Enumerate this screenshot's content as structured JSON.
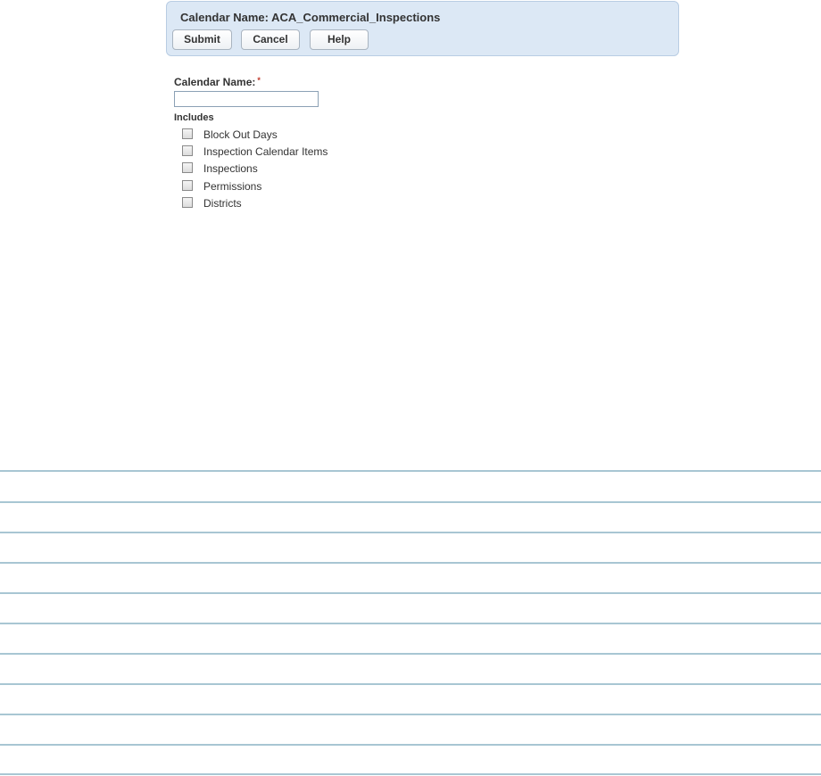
{
  "header": {
    "title": "Calendar Name: ACA_Commercial_Inspections",
    "buttons": {
      "submit": "Submit",
      "cancel": "Cancel",
      "help": "Help"
    }
  },
  "form": {
    "calendar_name_label": "Calendar Name:",
    "required_marker": "*",
    "calendar_name_value": "",
    "includes_label": "Includes",
    "includes": [
      {
        "label": "Block Out Days",
        "checked": false
      },
      {
        "label": "Inspection Calendar Items",
        "checked": false
      },
      {
        "label": "Inspections",
        "checked": false
      },
      {
        "label": "Permissions",
        "checked": false
      },
      {
        "label": "Districts",
        "checked": false
      }
    ]
  },
  "colors": {
    "header_bg": "#dce8f5",
    "header_border": "#b9cde3",
    "rule_line": "#a8c6d3",
    "required": "#c0392b"
  }
}
